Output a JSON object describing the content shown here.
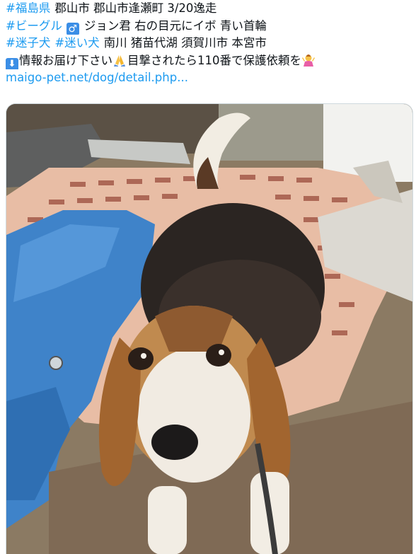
{
  "tweet": {
    "line1": {
      "tag": "#福島県",
      "text": "郡山市 郡山市逢瀬町 3/20逸走"
    },
    "line2": {
      "tag": "#ビーグル",
      "male_icon": "♂",
      "text": "ジョン君 右の目元にイボ 青い首輪"
    },
    "line3": {
      "tag1": "#迷子犬",
      "tag2": "#迷い犬",
      "text": "南川 猪苗代湖 須賀川市 本宮市"
    },
    "line4": {
      "down_icon": "⬇",
      "text1": "情報お届け下さい",
      "text2": "目撃されたら110番で保護依頼を"
    },
    "link": "maigo-pet.net/dog/detail.php..."
  },
  "icons": [
    "down-arrow-icon",
    "male-sign-icon",
    "folded-hands-icon",
    "person-gesturing-icon"
  ],
  "colors": {
    "hashtag": "#1d9bf0",
    "text": "#0f1419"
  }
}
